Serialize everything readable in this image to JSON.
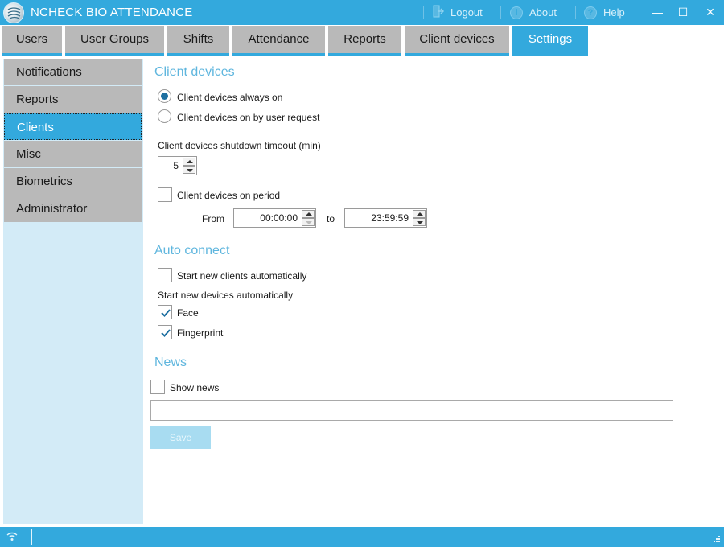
{
  "app": {
    "title": "NCHECK BIO ATTENDANCE"
  },
  "titlebar": {
    "logout_label": "Logout",
    "about_label": "About",
    "help_label": "Help",
    "minimize_glyph": "—",
    "maximize_glyph": "☐",
    "close_glyph": "✕"
  },
  "tabs": [
    {
      "label": "Users"
    },
    {
      "label": "User Groups"
    },
    {
      "label": "Shifts"
    },
    {
      "label": "Attendance"
    },
    {
      "label": "Reports"
    },
    {
      "label": "Client devices"
    },
    {
      "label": "Settings",
      "active": true
    }
  ],
  "sidebar": {
    "items": [
      {
        "label": "Notifications"
      },
      {
        "label": "Reports"
      },
      {
        "label": "Clients",
        "active": true
      },
      {
        "label": "Misc"
      },
      {
        "label": "Biometrics"
      },
      {
        "label": "Administrator"
      }
    ]
  },
  "client_devices": {
    "section_title": "Client devices",
    "radio_always_on": {
      "label": "Client devices always on",
      "checked": true
    },
    "radio_on_request": {
      "label": "Client devices on by user request",
      "checked": false
    },
    "shutdown_timeout_label": "Client devices shutdown timeout (min)",
    "shutdown_timeout_value": "5",
    "on_period": {
      "label": "Client devices on period",
      "checked": false
    },
    "from_label": "From",
    "from_value": "00:00:00",
    "to_label": "to",
    "to_value": "23:59:59"
  },
  "auto_connect": {
    "section_title": "Auto connect",
    "start_clients": {
      "label": "Start new clients automatically",
      "checked": false
    },
    "start_devices_label": "Start new devices automatically",
    "face": {
      "label": "Face",
      "checked": true
    },
    "fingerprint": {
      "label": "Fingerprint",
      "checked": true
    }
  },
  "news": {
    "section_title": "News",
    "show_news": {
      "label": "Show news",
      "checked": false
    },
    "input_value": "",
    "save_label": "Save"
  },
  "colors": {
    "accent": "#33a9dd",
    "tab_inactive": "#b9b9b9",
    "sidebar_bg": "#d3ebf7",
    "section_title": "#5fb6de"
  },
  "icons": {
    "logout": "logout-icon",
    "about": "about-icon",
    "help": "help-icon",
    "wifi": "wifi-icon",
    "resize": "resize-grip-icon"
  }
}
